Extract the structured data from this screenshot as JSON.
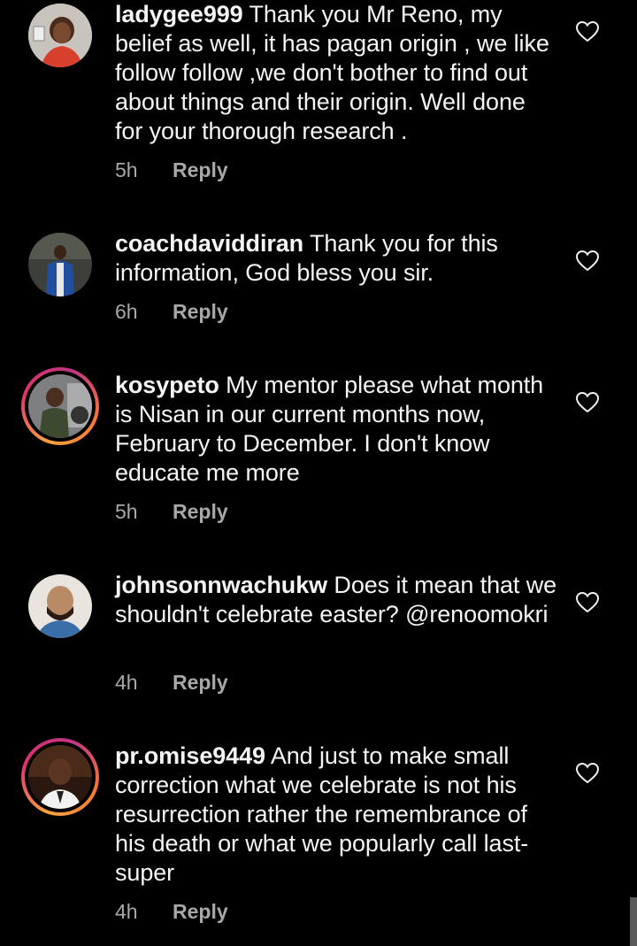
{
  "comments": [
    {
      "username": "ladygee999",
      "text": " Thank you Mr Reno, my belief as well, it has pagan origin , we like follow follow ,we don't bother to find out about things and their origin. Well done for your thorough research .",
      "time": "5h",
      "reply_label": "Reply",
      "avatar_icon": "profile-photo",
      "has_story_ring": false
    },
    {
      "username": "coachdaviddiran",
      "text": " Thank you for this information, God bless you sir.",
      "time": "6h",
      "reply_label": "Reply",
      "avatar_icon": "profile-photo",
      "has_story_ring": false
    },
    {
      "username": "kosypeto",
      "text": " My mentor please what month is Nisan in our current months now, February to December. I don't know educate me more",
      "time": "5h",
      "reply_label": "Reply",
      "avatar_icon": "profile-photo",
      "has_story_ring": true
    },
    {
      "username": "johnsonnwachukw",
      "text": " Does it mean that we shouldn't celebrate easter? @renoomokri",
      "time": "4h",
      "reply_label": "Reply",
      "avatar_icon": "profile-photo",
      "has_story_ring": false
    },
    {
      "username": "pr.omise9449",
      "text": " And just to make small correction what we celebrate is not his resurrection rather the remembrance of his death or what we popularly call last-super",
      "time": "4h",
      "reply_label": "Reply",
      "avatar_icon": "profile-photo",
      "has_story_ring": true
    }
  ],
  "colors": {
    "background": "#000000",
    "text": "#f5f5f5",
    "meta": "#a8a8a8",
    "story_ring_start": "#f9a23c",
    "story_ring_end": "#c13584"
  },
  "icons": {
    "like": "heart-outline-icon"
  }
}
